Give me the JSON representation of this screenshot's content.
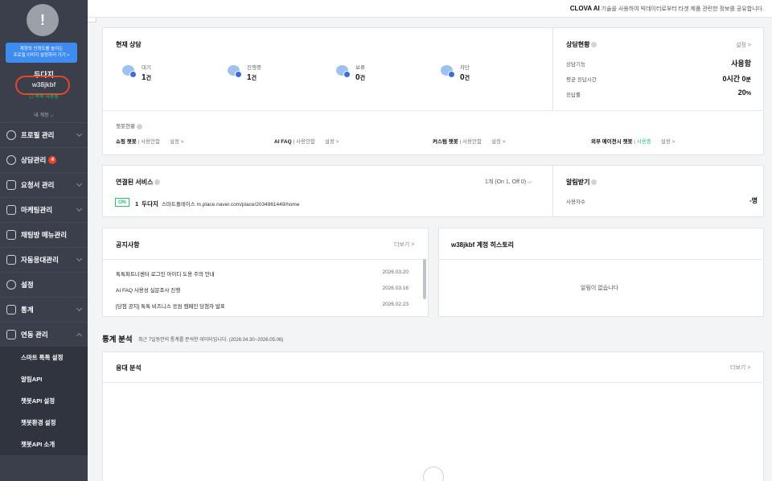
{
  "sidebar": {
    "avatar_symbol": "!",
    "tooltip_line1": "계정의 신뢰도를 높이는",
    "tooltip_line2": "프로필 이미지 설정하러 가기 >",
    "name": "두다지",
    "id": "w38jkbf",
    "status": "◎ 톡톡 사용중",
    "my_account": "내 계정 ⌵",
    "menu": [
      {
        "label": "프로필 관리"
      },
      {
        "label": "상담관리",
        "badge": "4"
      },
      {
        "label": "요청서 관리"
      },
      {
        "label": "마케팅관리"
      },
      {
        "label": "채팅방 메뉴관리"
      },
      {
        "label": "자동응대관리"
      },
      {
        "label": "설정"
      },
      {
        "label": "통계"
      },
      {
        "label": "연동 관리"
      }
    ],
    "submenu": [
      "스마트 톡톡 설정",
      "알림API",
      "챗봇API 설정",
      "챗봇환경 설정",
      "챗봇API 소개"
    ]
  },
  "topbar": {
    "brand": "CLOVA AI",
    "notice": " 기술을 사용하여 빅데이터로부터 타겟 제품 관련한 정보를 공유합니다."
  },
  "current": {
    "title": "현재 상담",
    "stats": [
      {
        "label": "대기",
        "value": "1",
        "unit": "건"
      },
      {
        "label": "진행중",
        "value": "1",
        "unit": "건"
      },
      {
        "label": "보류",
        "value": "0",
        "unit": "건"
      },
      {
        "label": "차단",
        "value": "0",
        "unit": "건"
      }
    ]
  },
  "status_panel": {
    "title": "상담현황",
    "settings": "설정 >",
    "rows": [
      {
        "label": "상담기능",
        "value": "사용함",
        "unit": ""
      },
      {
        "label": "평균 응답시간",
        "value": "0시간 0",
        "unit": "분"
      },
      {
        "label": "응답률",
        "value": "20",
        "unit": "%"
      }
    ]
  },
  "chatbot": {
    "title": "챗봇현황",
    "items": [
      {
        "name": "쇼핑 챗봇",
        "state": "사용안함",
        "settings": "설정 >"
      },
      {
        "name": "AI FAQ",
        "state": "사용안함",
        "settings": "설정 >"
      },
      {
        "name": "커스텀 챗봇",
        "state": "사용안함",
        "settings": "설정 >"
      },
      {
        "name": "외부 에이전시 챗봇",
        "state": "사용중",
        "settings": "설정 >"
      }
    ]
  },
  "services": {
    "title": "연결된 서비스",
    "count": "1개 (On 1, Off 0) ⌵",
    "on_tag": "ON",
    "item_no": "1",
    "item_name": "두다지",
    "item_detail": "스마트플레이스   m.place.naver.com/place/2034961449/home"
  },
  "alerts": {
    "title": "알림받기",
    "label": "사용자수",
    "value": "-명"
  },
  "notices": {
    "title": "공지사항",
    "more": "더보기 >",
    "items": [
      {
        "title": "톡톡파트너센터 로그인 아이디 도용 주의 안내",
        "date": "2026.03.20"
      },
      {
        "title": "AI FAQ 사용성 실문조사 진행",
        "date": "2026.03.16"
      },
      {
        "title": "[당첨 공지] 톡톡 비즈니스 응원 캠페인 당첨자 발표",
        "date": "2026.02.23"
      }
    ]
  },
  "history": {
    "title": "w38jkbf 계정 히스토리",
    "empty": "알림이 없습니다"
  },
  "stats": {
    "title": "통계 분석",
    "subtitle": "최근 7일동안의 통계를 분석한 데이터입니다. (2026.04.30~2026.05.06)",
    "response_title": "응대 분석",
    "more": "더보기 >"
  }
}
